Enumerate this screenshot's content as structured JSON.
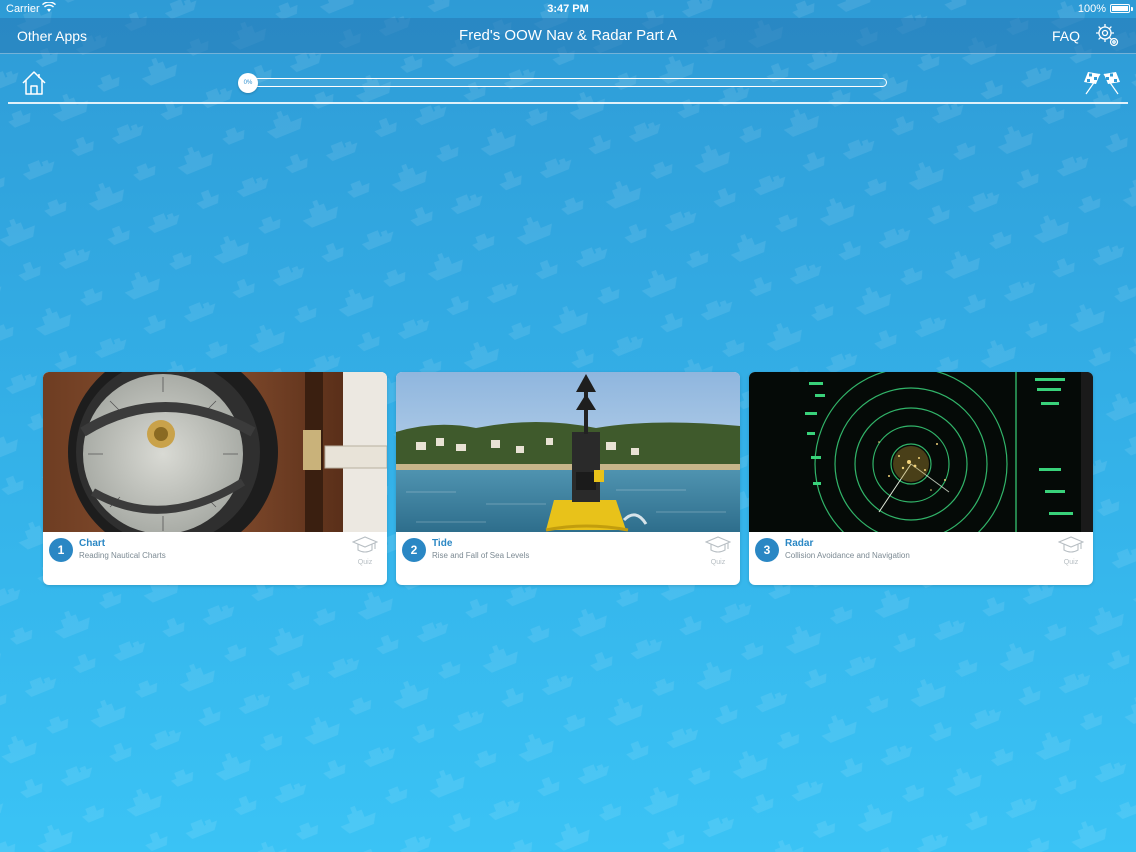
{
  "status_bar": {
    "carrier": "Carrier",
    "time": "3:47 PM",
    "battery": "100%"
  },
  "nav": {
    "left_label": "Other Apps",
    "title": "Fred's OOW Nav & Radar Part A",
    "faq_label": "FAQ",
    "settings_icon": "gear-icon"
  },
  "progress": {
    "value": 0,
    "label": "0%"
  },
  "toolbar": {
    "home_icon": "home-icon",
    "finish_icon": "checkered-flags-icon"
  },
  "modules": [
    {
      "number": "1",
      "title": "Chart",
      "subtitle": "Reading Nautical Charts",
      "quiz_label": "Quiz",
      "image": "compass-photo"
    },
    {
      "number": "2",
      "title": "Tide",
      "subtitle": "Rise and Fall of Sea Levels",
      "quiz_label": "Quiz",
      "image": "buoy-photo"
    },
    {
      "number": "3",
      "title": "Radar",
      "subtitle": "Collision Avoidance and Navigation",
      "quiz_label": "Quiz",
      "image": "radar-screen-photo"
    }
  ],
  "colors": {
    "accent": "#2a87c4",
    "background_top": "#2e9bd6",
    "background_bottom": "#3ac3f5"
  }
}
